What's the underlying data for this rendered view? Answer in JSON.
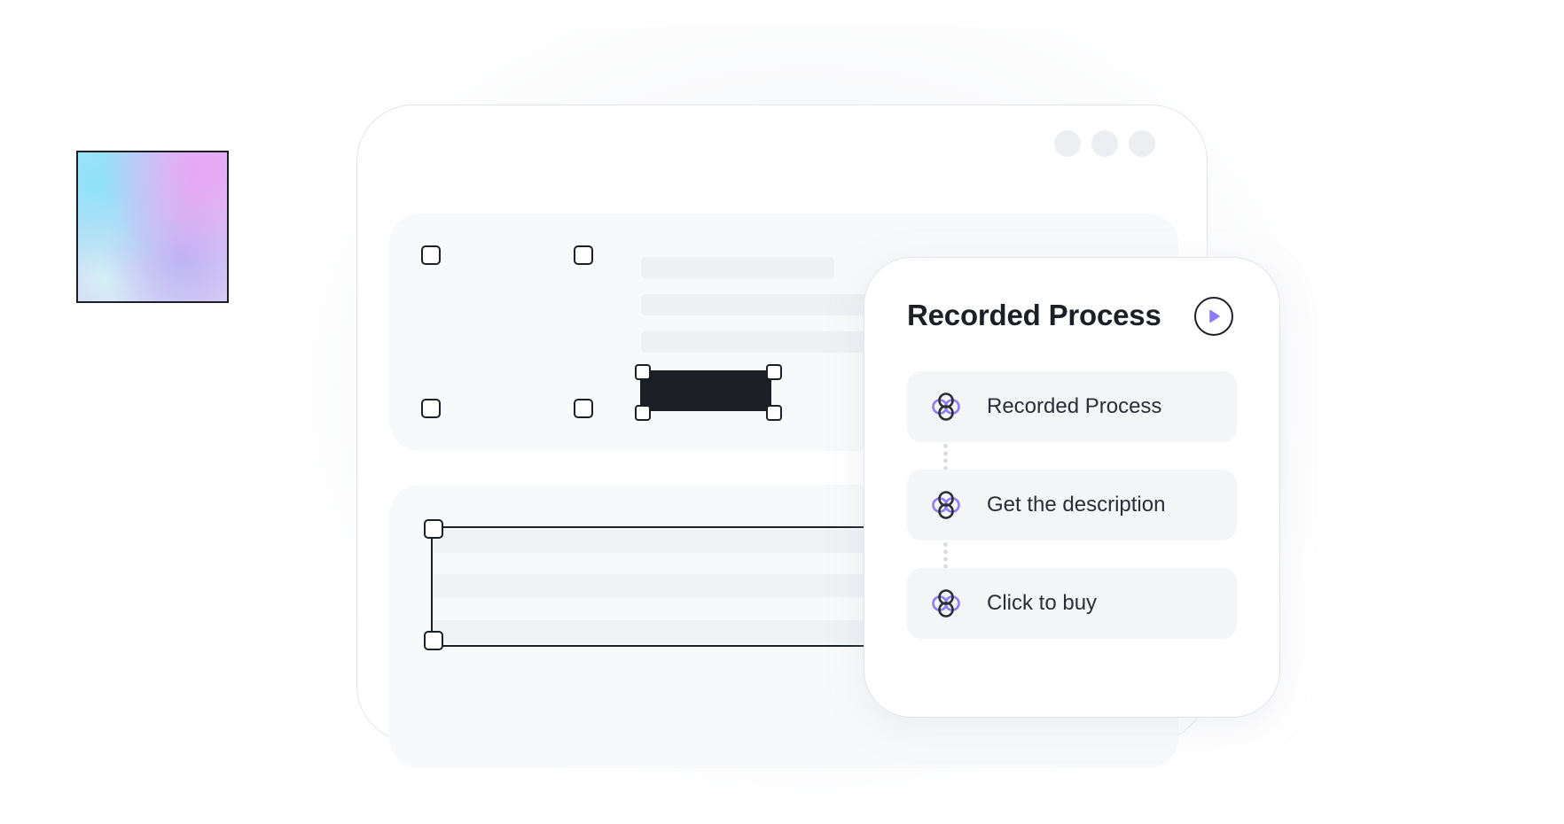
{
  "panel": {
    "title": "Recorded Process",
    "play_icon": "play-circle-icon",
    "steps": [
      {
        "label": "Recorded Process",
        "icon": "flower-node-icon"
      },
      {
        "label": "Get the description",
        "icon": "flower-node-icon"
      },
      {
        "label": "Click to buy",
        "icon": "flower-node-icon"
      }
    ]
  },
  "colors": {
    "accent": "#8d7cf5",
    "ink": "#1c2026",
    "surface": "#f4f5f7"
  }
}
